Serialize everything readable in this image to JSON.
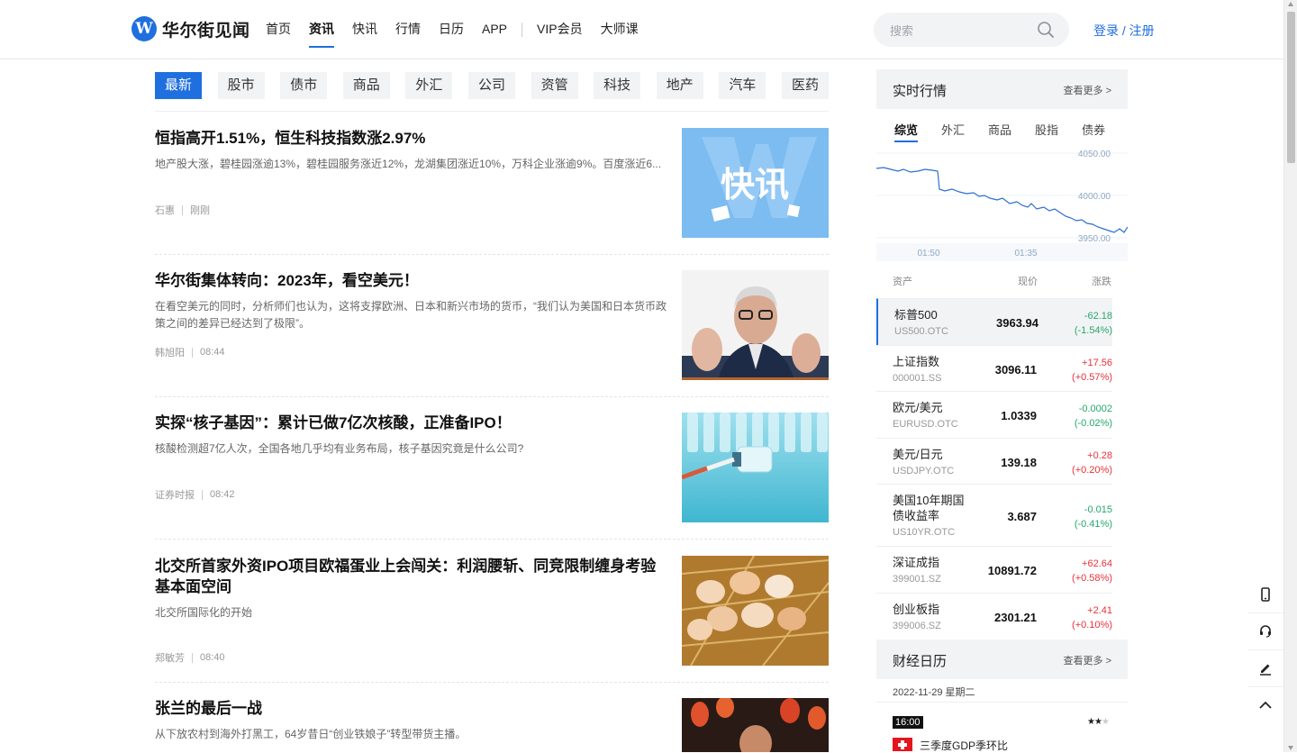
{
  "brand": {
    "logo_letter": "W",
    "name": "华尔街见闻"
  },
  "nav": [
    {
      "label": "首页",
      "active": false
    },
    {
      "label": "资讯",
      "active": true
    },
    {
      "label": "快讯",
      "active": false
    },
    {
      "label": "行情",
      "active": false
    },
    {
      "label": "日历",
      "active": false
    },
    {
      "label": "APP",
      "active": false
    },
    {
      "label": "VIP会员",
      "active": false
    },
    {
      "label": "大师课",
      "active": false
    }
  ],
  "search": {
    "placeholder": "搜索"
  },
  "login_label": "登录 / 注册",
  "categories": [
    "最新",
    "股市",
    "债市",
    "商品",
    "外汇",
    "公司",
    "资管",
    "科技",
    "地产",
    "汽车",
    "医药"
  ],
  "articles": [
    {
      "title": "恒指高开1.51%，恒生科技指数涨2.97%",
      "desc": "地产股大涨，碧桂园涨逾13%，碧桂园服务涨近12%，龙湖集团涨近10%，万科企业涨逾9%。百度涨近6...",
      "author": "石惠",
      "time": "刚刚",
      "image": "kuaixun-thumbnail",
      "image_text": "快讯"
    },
    {
      "title": "华尔街集体转向：2023年，看空美元！",
      "desc": "在看空美元的同时，分析师们也认为，这将支撑欧洲、日本和新兴市场的货币，“我们认为美国和日本货币政策之间的差异已经达到了极限”。",
      "author": "韩旭阳",
      "time": "08:44",
      "image": "man-raising-hands-photo"
    },
    {
      "title": "实探“核子基因”：累计已做7亿次核酸，正准备IPO！",
      "desc": "核酸检测超7亿人次，全国各地几乎均有业务布局，核子基因究竟是什么公司?",
      "author": "证券时报",
      "time": "08:42",
      "image": "vials-syringe-photo"
    },
    {
      "title": "北交所首家外资IPO项目欧福蛋业上会闯关：利润腰斩、同竞限制缠身考验基本面空间",
      "desc": "北交所国际化的开始",
      "author": "郑敏芳",
      "time": "08:40",
      "image": "eggs-in-nest-photo"
    },
    {
      "title": "张兰的最后一战",
      "desc": "从下放农村到海外打黑工，64岁昔日“创业铁娘子”转型带货主播。",
      "author": "",
      "time": "",
      "image": "woman-with-tulips-photo"
    }
  ],
  "market": {
    "title": "实时行情",
    "more": "查看更多 >",
    "tabs": [
      "综览",
      "外汇",
      "商品",
      "股指",
      "债券"
    ],
    "active_tab": "综览",
    "chart": {
      "y_ticks": [
        "4050.00",
        "4000.00",
        "3950.00"
      ],
      "x_ticks": [
        "01:50",
        "01:35"
      ]
    },
    "columns": [
      "资产",
      "现价",
      "涨跌"
    ],
    "rows": [
      {
        "name": "标普500",
        "code": "US500.OTC",
        "price": "3963.94",
        "change": "-62.18",
        "pct": "(-1.54%)",
        "dir": "down"
      },
      {
        "name": "上证指数",
        "code": "000001.SS",
        "price": "3096.11",
        "change": "+17.56",
        "pct": "(+0.57%)",
        "dir": "up"
      },
      {
        "name": "欧元/美元",
        "code": "EURUSD.OTC",
        "price": "1.0339",
        "change": "-0.0002",
        "pct": "(-0.02%)",
        "dir": "down"
      },
      {
        "name": "美元/日元",
        "code": "USDJPY.OTC",
        "price": "139.18",
        "change": "+0.28",
        "pct": "(+0.20%)",
        "dir": "up"
      },
      {
        "name": "美国10年期国债收益率",
        "code": "US10YR.OTC",
        "price": "3.687",
        "change": "-0.015",
        "pct": "(-0.41%)",
        "dir": "down"
      },
      {
        "name": "深证成指",
        "code": "399001.SZ",
        "price": "10891.72",
        "change": "+62.64",
        "pct": "(+0.58%)",
        "dir": "up"
      },
      {
        "name": "创业板指",
        "code": "399006.SZ",
        "price": "2301.21",
        "change": "+2.41",
        "pct": "(+0.10%)",
        "dir": "up"
      }
    ]
  },
  "calendar": {
    "title": "财经日历",
    "more": "查看更多 >",
    "date": "2022-11-29 星期二",
    "event": {
      "time": "16:00",
      "country_flag": "swiss-flag-icon",
      "stars": 2,
      "stars_max": 3,
      "title": "三季度GDP季环比"
    }
  },
  "tools": [
    "phone-icon",
    "headset-icon",
    "edit-icon",
    "back-to-top-icon"
  ],
  "colors": {
    "accent": "#1f6fde",
    "up": "#e8323b",
    "down": "#26a76c"
  }
}
